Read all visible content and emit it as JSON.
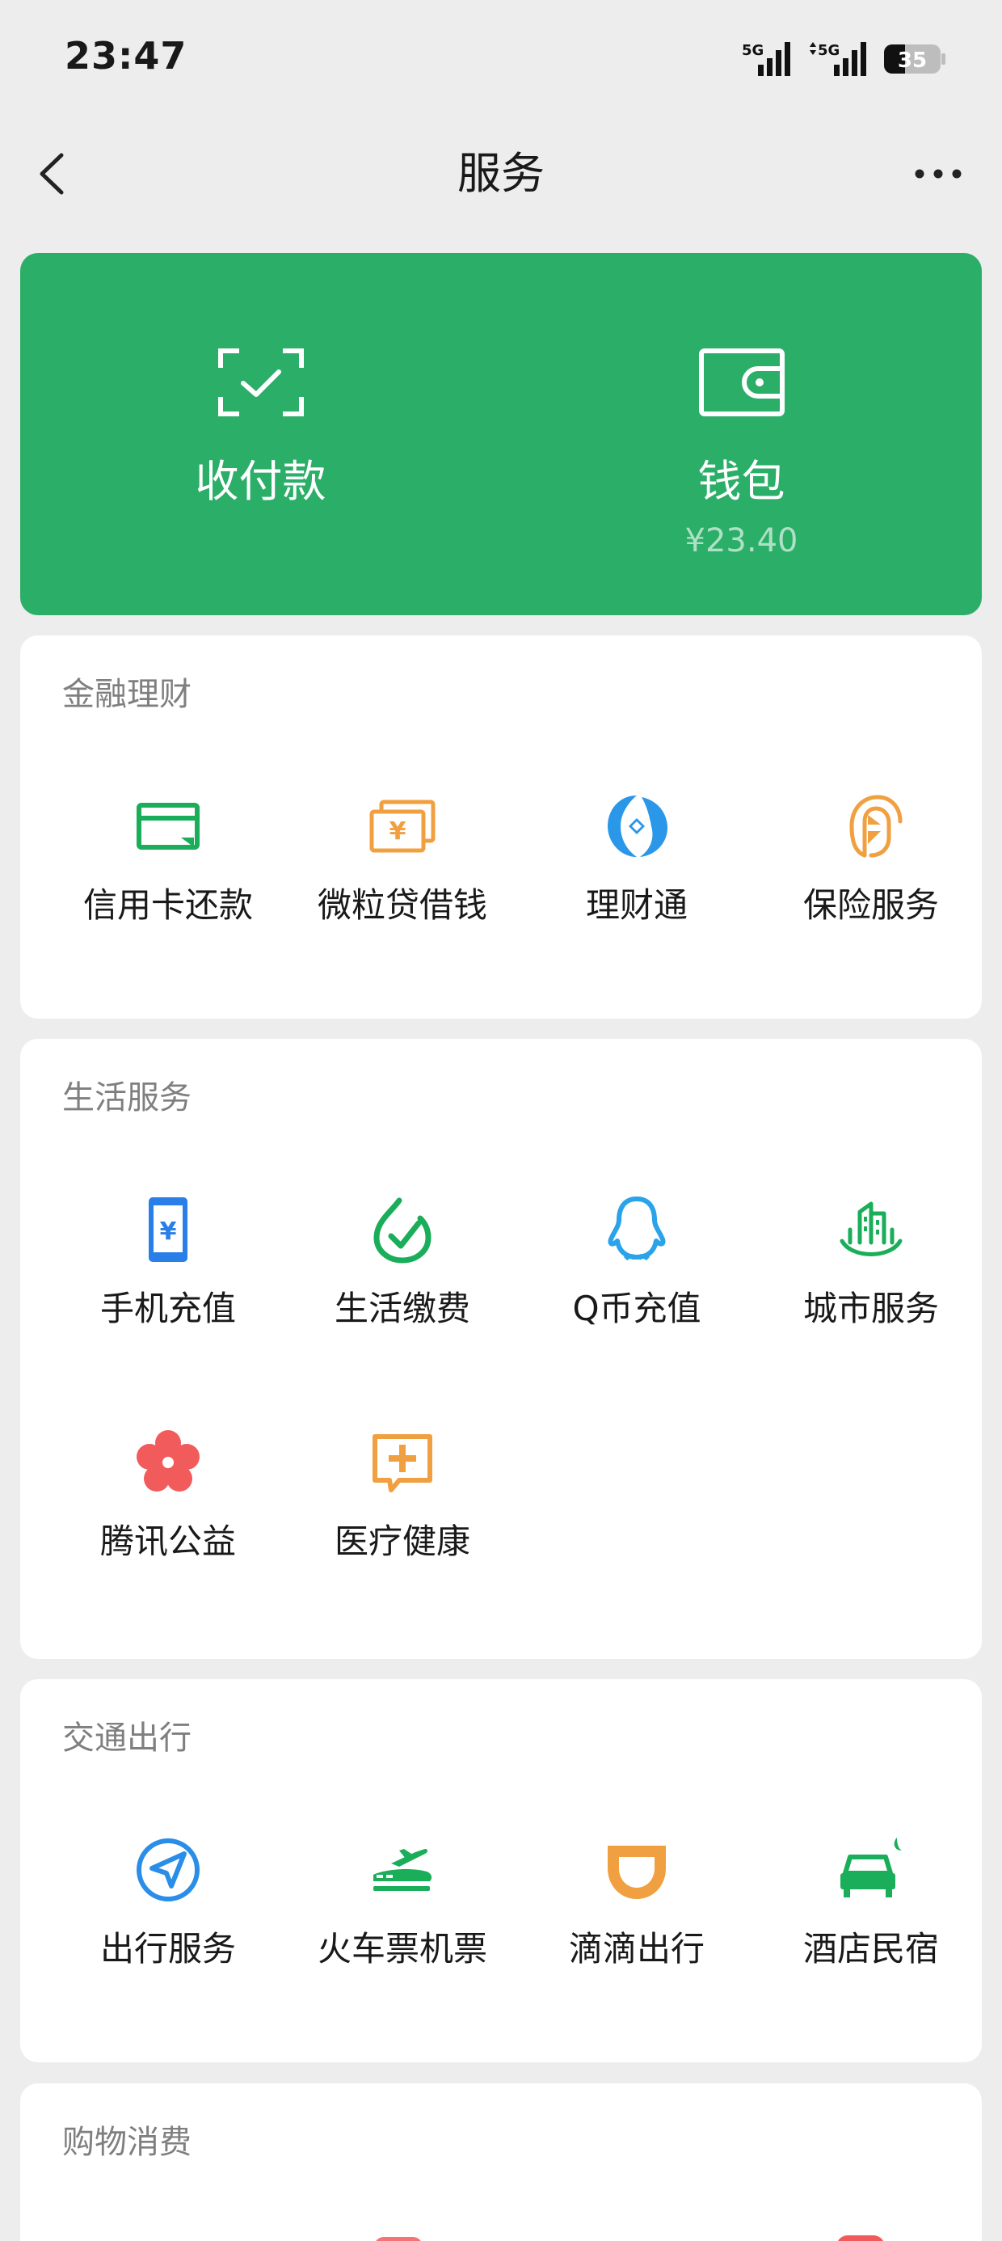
{
  "status_bar": {
    "time": "23:47",
    "signal1": "5G",
    "signal2": "5G",
    "battery": "35"
  },
  "nav": {
    "title": "服务",
    "back_icon": "chevron-left-icon",
    "more_icon": "more-dots-icon"
  },
  "wallet_card": {
    "color": "#2bae67",
    "pay": {
      "label": "收付款",
      "icon": "scan-check-icon"
    },
    "wallet": {
      "label": "钱包",
      "balance": "¥23.40",
      "icon": "wallet-icon"
    }
  },
  "sections": {
    "finance": {
      "title": "金融理财",
      "items": [
        {
          "label": "信用卡还款",
          "icon": "credit-card-icon",
          "color": "#1aad5a"
        },
        {
          "label": "微粒贷借钱",
          "icon": "yuan-cards-icon",
          "color": "#f0a040"
        },
        {
          "label": "理财通",
          "icon": "licaitong-icon",
          "color": "#2a97e8"
        },
        {
          "label": "保险服务",
          "icon": "insurance-icon",
          "color": "#f0a040"
        }
      ]
    },
    "life": {
      "title": "生活服务",
      "items": [
        {
          "label": "手机充值",
          "icon": "phone-yuan-icon",
          "color": "#2a7ee8"
        },
        {
          "label": "生活缴费",
          "icon": "check-drop-icon",
          "color": "#1aad5a"
        },
        {
          "label": "Q币充值",
          "icon": "qq-penguin-icon",
          "color": "#2aa3e8"
        },
        {
          "label": "城市服务",
          "icon": "city-building-icon",
          "color": "#1aad5a"
        },
        {
          "label": "腾讯公益",
          "icon": "flower-icon",
          "color": "#f25b5b"
        },
        {
          "label": "医疗健康",
          "icon": "medical-cross-icon",
          "color": "#f0a040"
        }
      ]
    },
    "transport": {
      "title": "交通出行",
      "items": [
        {
          "label": "出行服务",
          "icon": "navigation-arrow-icon",
          "color": "#2a8ee8"
        },
        {
          "label": "火车票机票",
          "icon": "train-plane-icon",
          "color": "#1aad5a"
        },
        {
          "label": "滴滴出行",
          "icon": "didi-icon",
          "color": "#f0a040"
        },
        {
          "label": "酒店民宿",
          "icon": "hotel-bed-icon",
          "color": "#1aad5a"
        }
      ]
    },
    "shopping": {
      "title": "购物消费"
    }
  }
}
